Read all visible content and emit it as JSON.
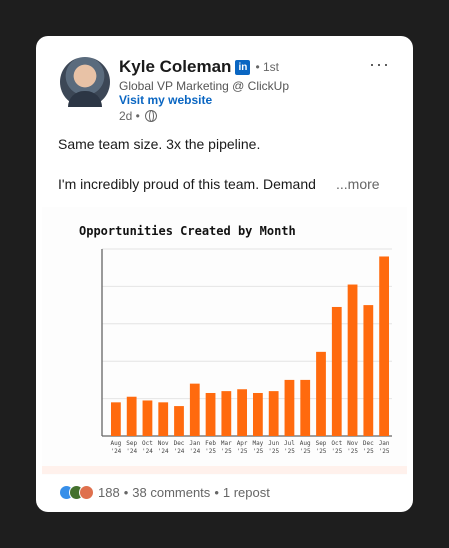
{
  "post": {
    "author": "Kyle Coleman",
    "badge": "in",
    "degree": "• 1st",
    "headline": "Global VP Marketing @ ClickUp",
    "website_link": "Visit my website",
    "time": "2d •",
    "more_menu": "···",
    "text_line1": "Same team size. 3x the pipeline.",
    "text_line2": "I'm incredibly proud of this team. Demand",
    "see_more": "...more"
  },
  "social": {
    "reactions": "188",
    "comments": "38 comments",
    "reposts": "1 repost",
    "dot": "•"
  },
  "colors": {
    "bar": "#ff6a0e",
    "link": "#0a66c2"
  },
  "chart_data": {
    "type": "bar",
    "title": "Opportunities Created by Month",
    "categories": [
      [
        "Aug",
        "'24"
      ],
      [
        "Sep",
        "'24"
      ],
      [
        "Oct",
        "'24"
      ],
      [
        "Nov",
        "'24"
      ],
      [
        "Dec",
        "'24"
      ],
      [
        "Jan",
        "'24"
      ],
      [
        "Feb",
        "'25"
      ],
      [
        "Mar",
        "'25"
      ],
      [
        "Apr",
        "'25"
      ],
      [
        "May",
        "'25"
      ],
      [
        "Jun",
        "'25"
      ],
      [
        "Jul",
        "'25"
      ],
      [
        "Aug",
        "'25"
      ],
      [
        "Sep",
        "'25"
      ],
      [
        "Oct",
        "'25"
      ],
      [
        "Nov",
        "'25"
      ],
      [
        "Dec",
        "'25"
      ],
      [
        "Jan",
        "'25"
      ]
    ],
    "values": [
      18,
      21,
      19,
      18,
      16,
      28,
      23,
      24,
      25,
      23,
      24,
      30,
      30,
      45,
      69,
      81,
      70,
      96
    ],
    "ylim": [
      0,
      100
    ],
    "grid": true,
    "legend": "none"
  }
}
